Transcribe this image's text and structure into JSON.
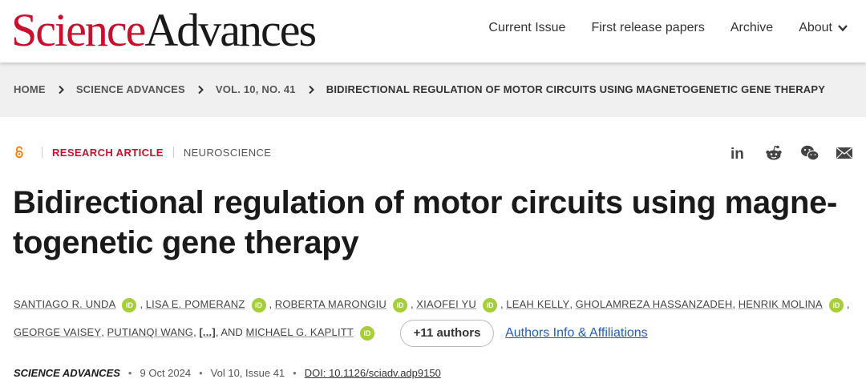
{
  "header": {
    "logo_part1": "Science",
    "logo_part2": "Advances",
    "nav": [
      "Current Issue",
      "First release papers",
      "Archive",
      "About"
    ]
  },
  "breadcrumb": {
    "items": [
      "HOME",
      "SCIENCE ADVANCES",
      "VOL. 10, NO. 41",
      "BIDIRECTIONAL REGULATION OF MOTOR CIRCUITS USING MAGNETOGENETIC GENE THERAPY"
    ]
  },
  "article": {
    "type": "RESEARCH ARTICLE",
    "subject": "NEUROSCIENCE",
    "title": "Bidirectional regulation of motor circuits using magne-togenetic gene therapy",
    "authors": [
      "SANTIAGO R. UNDA",
      "LISA E. POMERANZ",
      "ROBERTA MARONGIU",
      "XIAOFEI YU",
      "LEAH KELLY",
      "GHOLAMREZA HASSANZADEH",
      "HENRIK MOLINA",
      "GEORGE VAISEY",
      "PUTIANQI WANG",
      "[...]",
      "MICHAEL G. KAPLITT"
    ],
    "and_text": ", AND",
    "orcid_label": "iD",
    "more_authors": "+11 authors",
    "affiliations_link": "Authors Info & Affiliations",
    "journal": "SCIENCE ADVANCES",
    "date": "9 Oct 2024",
    "volume": "Vol 10, Issue 41",
    "doi": "DOI: 10.1126/sciadv.adp9150"
  },
  "colors": {
    "brand_red": "#c8102e",
    "orcid_green": "#a6ce39",
    "link_blue": "#1f5fbf"
  }
}
